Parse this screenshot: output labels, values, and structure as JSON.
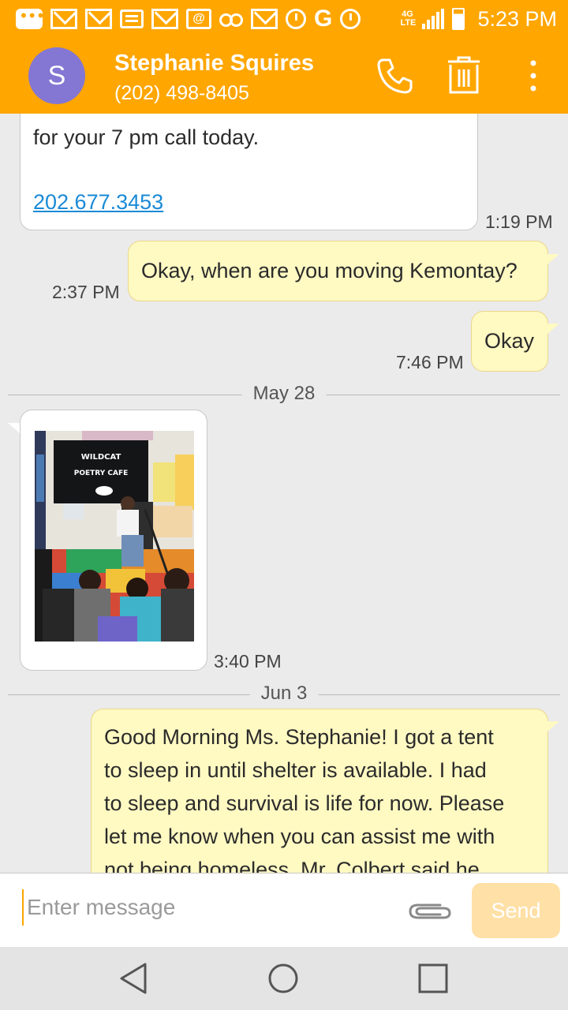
{
  "status_bar": {
    "time": "5:23 PM",
    "network": "4G",
    "network_sub": "LTE",
    "google_letter": "G",
    "at_symbol": "@",
    "notification_icons": [
      "more-notifications-icon",
      "gmail-icon",
      "gmail-icon",
      "message-icon",
      "gmail-icon",
      "email-at-icon",
      "voicemail-icon",
      "gmail-icon",
      "alarm-icon",
      "google-icon",
      "alarm-icon"
    ],
    "battery_level": 0.78
  },
  "header": {
    "avatar_letter": "S",
    "contact_name": "Stephanie Squires",
    "contact_number": "(202) 498-8405",
    "actions": [
      "phone-icon",
      "trash-icon",
      "overflow-menu-icon"
    ]
  },
  "messages": [
    {
      "direction": "incoming",
      "text": "for your 7 pm call today.",
      "link": "202.677.3453",
      "time": "1:19 PM"
    },
    {
      "direction": "outgoing",
      "text": "Okay, when are you moving Kemontay?",
      "time": "2:37 PM"
    },
    {
      "direction": "outgoing",
      "text": "Okay",
      "time": "7:46 PM"
    },
    {
      "date_divider": "May 28"
    },
    {
      "direction": "incoming",
      "type": "image",
      "image_text": [
        "WILDCAT",
        "POETRY CAFE"
      ],
      "time": "3:40 PM"
    },
    {
      "date_divider": "Jun 3"
    },
    {
      "direction": "outgoing",
      "lines": [
        "Good Morning Ms. Stephanie! I got a tent",
        "to sleep in until shelter is available. I had",
        "to sleep and survival is life for now. Please",
        "let me know when you can assist me with",
        "not being homeless. Mr. Colbert said he"
      ]
    }
  ],
  "composer": {
    "placeholder": "Enter message",
    "send_label": "Send",
    "attach_icon": "paperclip-icon"
  },
  "navigation": [
    "back-icon",
    "home-icon",
    "recents-icon"
  ],
  "colors": {
    "accent": "#ffa600",
    "avatar": "#8476d3",
    "outgoing_bubble": "#fff9c2",
    "incoming_bubble": "#ffffff",
    "link": "#1a8ad6",
    "send_disabled": "#ffe0a6"
  }
}
